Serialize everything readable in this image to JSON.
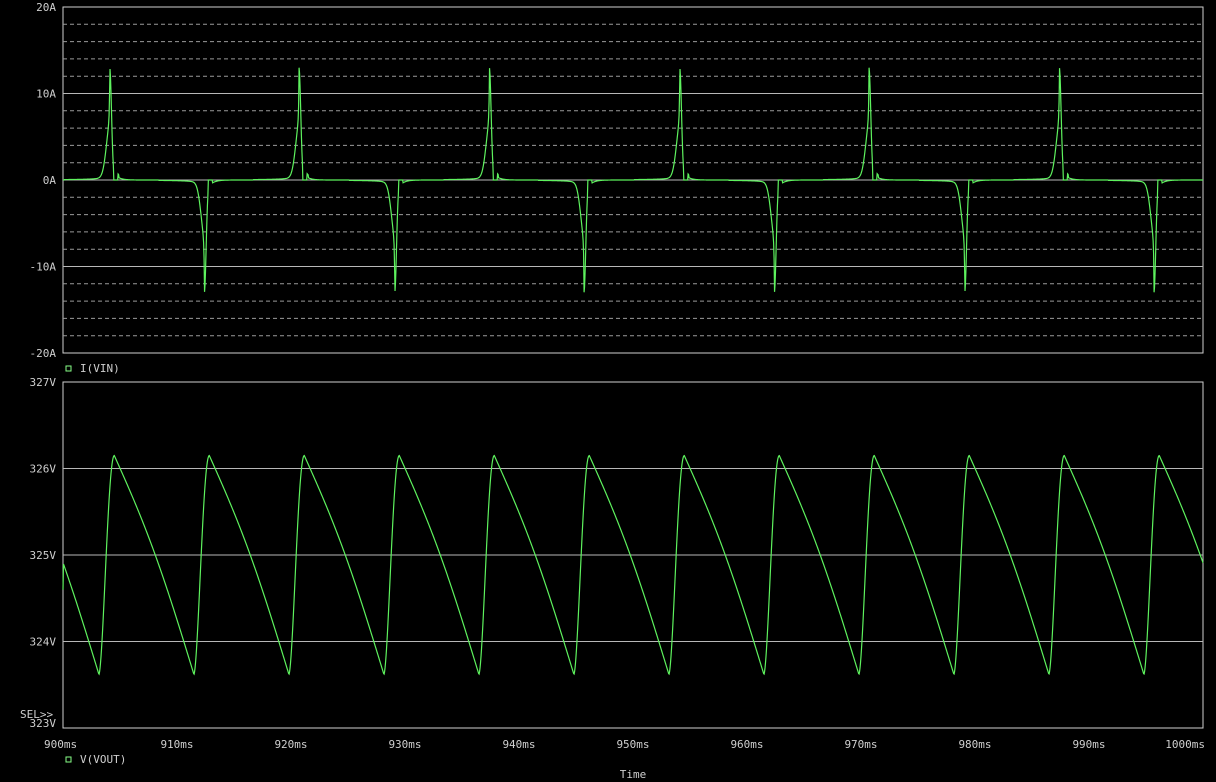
{
  "chart_data": [
    {
      "type": "line",
      "panel": "top",
      "ylabel_ticks": [
        "20A",
        "10A",
        "0A",
        "-10A",
        "-20A"
      ],
      "ylim": [
        -20,
        20
      ],
      "y_unit": "A",
      "grid": true,
      "legend_marker_color": "#88ff88",
      "series": [
        {
          "name": "I(VIN)",
          "color": "#5ef25e",
          "description_points": {
            "period_ms": 16.67,
            "positive_peak_times_ms": [
              904.1,
              920.7,
              937.4,
              954.1,
              970.7,
              987.4
            ],
            "negative_peak_times_ms": [
              912.4,
              929.1,
              945.7,
              962.4,
              979.1,
              995.7
            ],
            "peak_A": 13
          }
        }
      ]
    },
    {
      "type": "line",
      "panel": "bottom",
      "ylabel_ticks": [
        "327V",
        "326V",
        "325V",
        "324V",
        "323V"
      ],
      "ylim": [
        323,
        327
      ],
      "y_unit": "V",
      "grid": true,
      "xlim": [
        900,
        1000
      ],
      "x_unit": "ms",
      "x_ticks": [
        "900ms",
        "910ms",
        "920ms",
        "930ms",
        "940ms",
        "950ms",
        "960ms",
        "970ms",
        "980ms",
        "990ms",
        "1000ms"
      ],
      "xlabel": "Time",
      "legend_marker_color": "#88ff88",
      "series": [
        {
          "name": "V(VOUT)",
          "color": "#5ef25e",
          "description_points": {
            "period_ms": 8.333,
            "max_V": 326.15,
            "min_V": 323.62,
            "start_V": 324.6,
            "peak_times_ms": [
              904.5,
              912.8,
              921.2,
              929.5,
              937.8,
              946.2,
              954.5,
              962.8,
              971.2,
              979.5,
              987.8,
              996.2
            ],
            "trough_times_ms": [
              903.2,
              911.5,
              919.9,
              928.2,
              936.5,
              944.9,
              953.2,
              961.5,
              969.9,
              978.2,
              986.5,
              994.9
            ]
          }
        }
      ]
    }
  ],
  "selection_marker": "SEL>>",
  "colors": {
    "background": "#000000",
    "frame": "#d0d0d0",
    "grid_major": "#b8b8b8",
    "grid_minor": "#9a9a9a",
    "text": "#cfcfcf",
    "trace": "#5ef25e"
  }
}
